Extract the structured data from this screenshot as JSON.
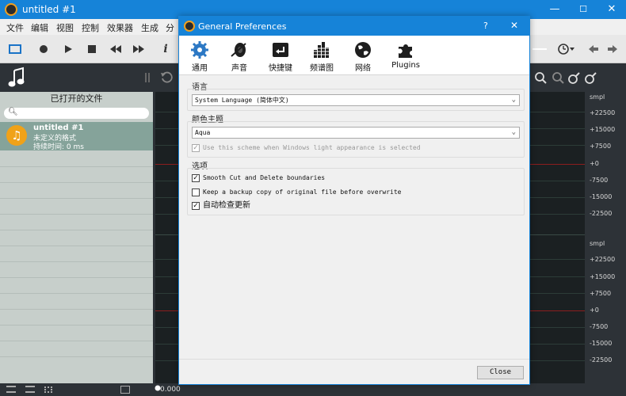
{
  "main_window": {
    "title": "untitled #1",
    "min_glyph": "—",
    "max_glyph": "☐",
    "close_glyph": "✕"
  },
  "menu": [
    "文件",
    "编辑",
    "视图",
    "控制",
    "效果器",
    "生成",
    "分"
  ],
  "toolbar": {
    "info_glyph": "i"
  },
  "file_panel": {
    "title": "已打开的文件",
    "file": {
      "name": "untitled #1",
      "format": "未定义的格式",
      "duration": "持续时间: 0 ms"
    }
  },
  "ruler": {
    "unit": "smpl",
    "top_labels": [
      "+22500",
      "+15000",
      "+7500",
      "+0",
      "-7500",
      "-15000",
      "-22500"
    ],
    "bottom_labels": [
      "+22500",
      "+15000",
      "+7500",
      "+0",
      "-7500",
      "-15000",
      "-22500"
    ]
  },
  "timeline": {
    "start": "0.000"
  },
  "dialog": {
    "title": "General Preferences",
    "help": "?",
    "close_glyph": "✕",
    "tabs": [
      {
        "label": "通用",
        "icon": "gear-icon"
      },
      {
        "label": "声音",
        "icon": "speaker-icon"
      },
      {
        "label": "快捷键",
        "icon": "return-key-icon"
      },
      {
        "label": "频谱图",
        "icon": "spectrum-icon"
      },
      {
        "label": "网络",
        "icon": "globe-icon"
      },
      {
        "label": "Plugins",
        "icon": "puzzle-icon"
      }
    ],
    "language": {
      "label": "语言",
      "value": "System Language (简体中文)"
    },
    "theme": {
      "label": "颜色主题",
      "value": "Aqua",
      "scheme_option": "Use this scheme when Windows light appearance is selected",
      "scheme_checked": true
    },
    "options": {
      "label": "选项",
      "items": [
        {
          "label": "Smooth Cut and Delete boundaries",
          "checked": true
        },
        {
          "label": "Keep a backup copy of original file before overwrite",
          "checked": false
        },
        {
          "label": "自动检查更新",
          "checked": true
        }
      ]
    },
    "close_button": "Close"
  },
  "colors": {
    "accent": "#1683d8",
    "file_highlight": "#85a39a",
    "file_icon": "#f0a218",
    "waveform_bg": "#1b2022"
  }
}
